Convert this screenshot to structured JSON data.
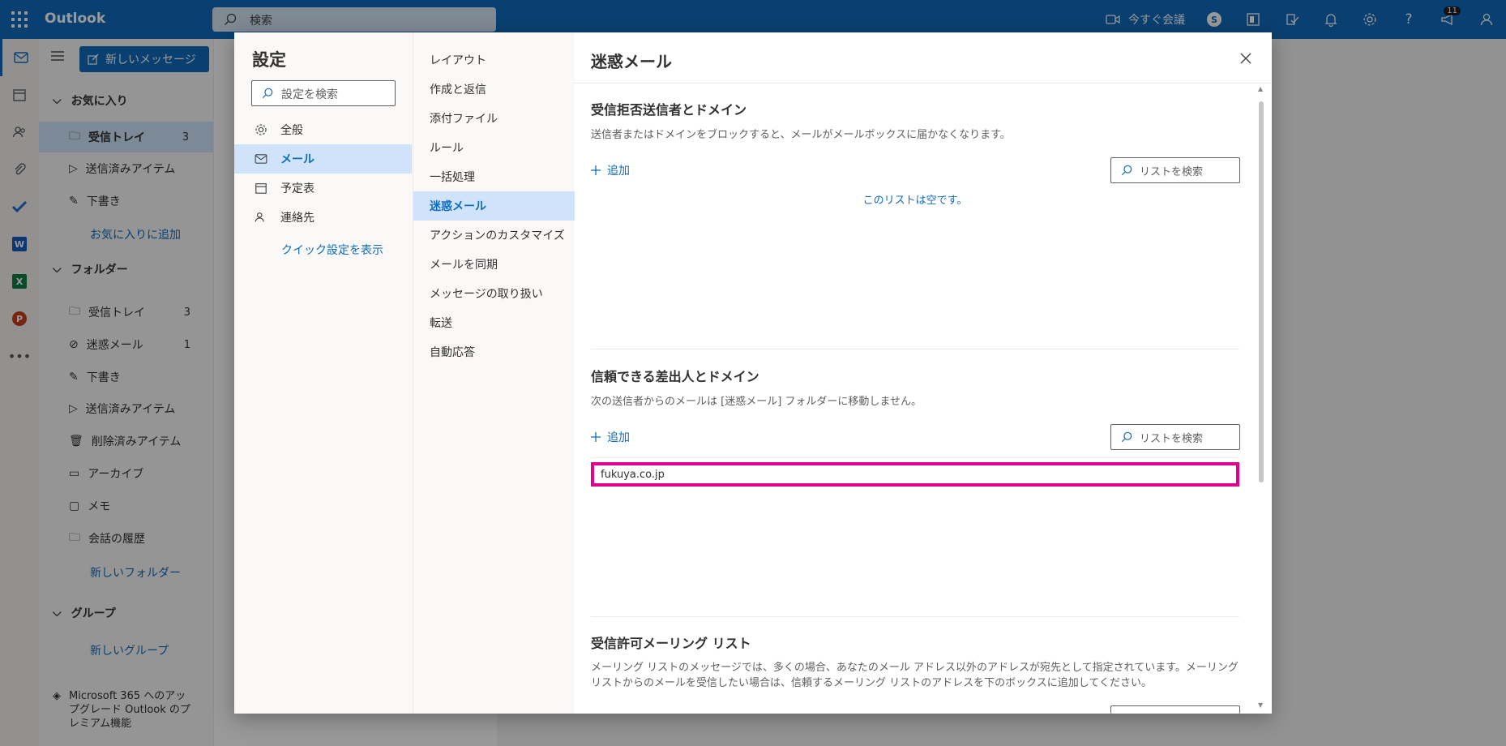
{
  "app": {
    "title": "Outlook"
  },
  "topbar": {
    "search_placeholder": "検索",
    "meet_now": "今すぐ会議",
    "notification_count": "11"
  },
  "folders": {
    "new_message": "新しいメッセージ",
    "favorites_header": "お気に入り",
    "favorites": [
      {
        "label": "受信トレイ",
        "count": "3"
      },
      {
        "label": "送信済みアイテム",
        "count": ""
      },
      {
        "label": "下書き",
        "count": ""
      }
    ],
    "add_favorite": "お気に入りに追加",
    "folders_header": "フォルダー",
    "items": [
      {
        "label": "受信トレイ",
        "count": "3"
      },
      {
        "label": "迷惑メール",
        "count": "1"
      },
      {
        "label": "下書き",
        "count": ""
      },
      {
        "label": "送信済みアイテム",
        "count": ""
      },
      {
        "label": "削除済みアイテム",
        "count": ""
      },
      {
        "label": "アーカイブ",
        "count": ""
      },
      {
        "label": "メモ",
        "count": ""
      },
      {
        "label": "会話の履歴",
        "count": ""
      }
    ],
    "new_folder": "新しいフォルダー",
    "groups_header": "グループ",
    "new_group": "新しいグループ",
    "upgrade": "Microsoft 365 へのアップグレード Outlook のプレミアム機能"
  },
  "settings": {
    "title": "設定",
    "search_placeholder": "設定を検索",
    "categories": [
      {
        "label": "全般"
      },
      {
        "label": "メール"
      },
      {
        "label": "予定表"
      },
      {
        "label": "連絡先"
      }
    ],
    "quick_settings": "クイック設定を表示",
    "subcategories": [
      "レイアウト",
      "作成と返信",
      "添付ファイル",
      "ルール",
      "一括処理",
      "迷惑メール",
      "アクションのカスタマイズ",
      "メールを同期",
      "メッセージの取り扱い",
      "転送",
      "自動応答"
    ]
  },
  "junk": {
    "title": "迷惑メール",
    "blocked": {
      "title": "受信拒否送信者とドメイン",
      "desc": "送信者またはドメインをブロックすると、メールがメールボックスに届かなくなります。",
      "add": "追加",
      "search": "リストを検索",
      "empty": "このリストは空です。"
    },
    "safe": {
      "title": "信頼できる差出人とドメイン",
      "desc": "次の送信者からのメールは [迷惑メール] フォルダーに移動しません。",
      "add": "追加",
      "search": "リストを検索",
      "entries": [
        "fukuya.co.jp"
      ]
    },
    "mailing": {
      "title": "受信許可メーリング リスト",
      "desc": "メーリング リストのメッセージでは、多くの場合、あなたのメール アドレス以外のアドレスが宛先として指定されています。メーリング リストからのメールを受信したい場合は、信頼するメーリング リストのアドレスを下のボックスに追加してください。"
    }
  }
}
